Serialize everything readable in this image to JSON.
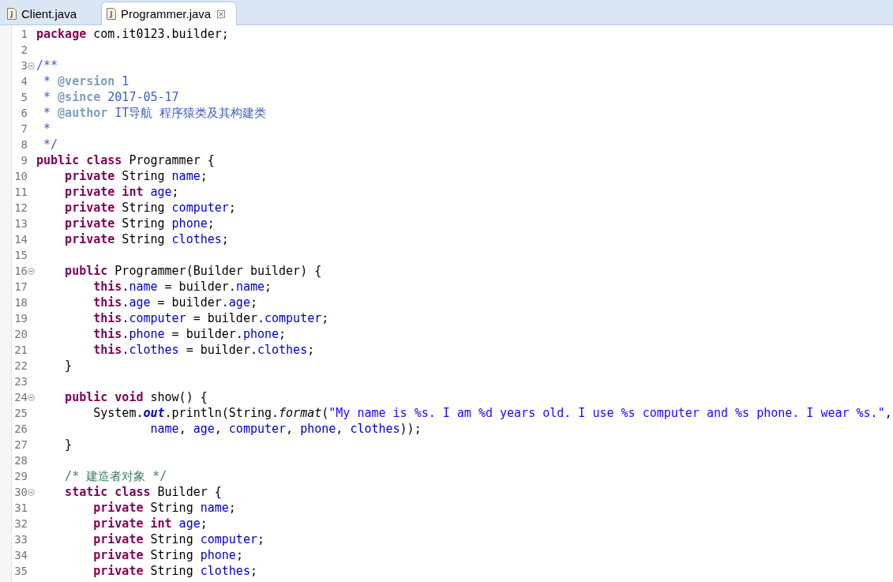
{
  "tabs": [
    {
      "label": "Client.java",
      "selected": false
    },
    {
      "label": "Programmer.java",
      "selected": true
    }
  ],
  "editor": {
    "lines": [
      {
        "number": "1",
        "tokens": [
          {
            "text": "package",
            "kind": "keyword"
          },
          {
            "text": " com.it0123.builder;",
            "kind": "plain"
          }
        ]
      },
      {
        "number": "2"
      },
      {
        "number": "3",
        "expanded": true,
        "tokens": [
          {
            "text": "/**",
            "kind": "javadoc"
          }
        ]
      },
      {
        "number": "4",
        "tokens": [
          {
            "text": " * ",
            "kind": "javadoc"
          },
          {
            "text": "@version",
            "kind": "javadoc-tag"
          },
          {
            "text": " 1",
            "kind": "javadoc"
          }
        ]
      },
      {
        "number": "5",
        "tokens": [
          {
            "text": " * ",
            "kind": "javadoc"
          },
          {
            "text": "@since",
            "kind": "javadoc-tag"
          },
          {
            "text": " 2017-05-17",
            "kind": "javadoc"
          }
        ]
      },
      {
        "number": "6",
        "tokens": [
          {
            "text": " * ",
            "kind": "javadoc"
          },
          {
            "text": "@author",
            "kind": "javadoc-tag"
          },
          {
            "text": " IT导航 程序猿类及其构建类",
            "kind": "javadoc"
          }
        ]
      },
      {
        "number": "7",
        "tokens": [
          {
            "text": " *",
            "kind": "javadoc"
          }
        ]
      },
      {
        "number": "8",
        "tokens": [
          {
            "text": " */",
            "kind": "javadoc"
          }
        ]
      },
      {
        "number": "9",
        "tokens": [
          {
            "text": "public class",
            "kind": "keyword"
          },
          {
            "text": " Programmer {",
            "kind": "plain"
          }
        ]
      },
      {
        "number": "10",
        "tokens": [
          {
            "text": "    private",
            "kind": "keyword"
          },
          {
            "text": " String ",
            "kind": "plain"
          },
          {
            "text": "name",
            "kind": "field"
          },
          {
            "text": ";",
            "kind": "plain"
          }
        ]
      },
      {
        "number": "11",
        "tokens": [
          {
            "text": "    private int",
            "kind": "keyword"
          },
          {
            "text": " age",
            "kind": "field"
          },
          {
            "text": ";",
            "kind": "plain"
          }
        ]
      },
      {
        "number": "12",
        "tokens": [
          {
            "text": "    private",
            "kind": "keyword"
          },
          {
            "text": " String ",
            "kind": "plain"
          },
          {
            "text": "computer",
            "kind": "field"
          },
          {
            "text": ";",
            "kind": "plain"
          }
        ]
      },
      {
        "number": "13",
        "tokens": [
          {
            "text": "    private",
            "kind": "keyword"
          },
          {
            "text": " String ",
            "kind": "plain"
          },
          {
            "text": "phone",
            "kind": "field"
          },
          {
            "text": ";",
            "kind": "plain"
          }
        ]
      },
      {
        "number": "14",
        "tokens": [
          {
            "text": "    private",
            "kind": "keyword"
          },
          {
            "text": " String ",
            "kind": "plain"
          },
          {
            "text": "clothes",
            "kind": "field"
          },
          {
            "text": ";",
            "kind": "plain"
          }
        ]
      },
      {
        "number": "15"
      },
      {
        "number": "16",
        "expanded": true,
        "tokens": [
          {
            "text": "    public",
            "kind": "keyword"
          },
          {
            "text": " Programmer(Builder builder) {",
            "kind": "plain"
          }
        ]
      },
      {
        "number": "17",
        "tokens": [
          {
            "text": "        this",
            "kind": "keyword"
          },
          {
            "text": ".",
            "kind": "plain"
          },
          {
            "text": "name",
            "kind": "field"
          },
          {
            "text": " = builder.",
            "kind": "plain"
          },
          {
            "text": "name",
            "kind": "field"
          },
          {
            "text": ";",
            "kind": "plain"
          }
        ]
      },
      {
        "number": "18",
        "tokens": [
          {
            "text": "        this",
            "kind": "keyword"
          },
          {
            "text": ".",
            "kind": "plain"
          },
          {
            "text": "age",
            "kind": "field"
          },
          {
            "text": " = builder.",
            "kind": "plain"
          },
          {
            "text": "age",
            "kind": "field"
          },
          {
            "text": ";",
            "kind": "plain"
          }
        ]
      },
      {
        "number": "19",
        "tokens": [
          {
            "text": "        this",
            "kind": "keyword"
          },
          {
            "text": ".",
            "kind": "plain"
          },
          {
            "text": "computer",
            "kind": "field"
          },
          {
            "text": " = builder.",
            "kind": "plain"
          },
          {
            "text": "computer",
            "kind": "field"
          },
          {
            "text": ";",
            "kind": "plain"
          }
        ]
      },
      {
        "number": "20",
        "tokens": [
          {
            "text": "        this",
            "kind": "keyword"
          },
          {
            "text": ".",
            "kind": "plain"
          },
          {
            "text": "phone",
            "kind": "field"
          },
          {
            "text": " = builder.",
            "kind": "plain"
          },
          {
            "text": "phone",
            "kind": "field"
          },
          {
            "text": ";",
            "kind": "plain"
          }
        ]
      },
      {
        "number": "21",
        "tokens": [
          {
            "text": "        this",
            "kind": "keyword"
          },
          {
            "text": ".",
            "kind": "plain"
          },
          {
            "text": "clothes",
            "kind": "field"
          },
          {
            "text": " = builder.",
            "kind": "plain"
          },
          {
            "text": "clothes",
            "kind": "field"
          },
          {
            "text": ";",
            "kind": "plain"
          }
        ]
      },
      {
        "number": "22",
        "tokens": [
          {
            "text": "    }",
            "kind": "plain"
          }
        ]
      },
      {
        "number": "23"
      },
      {
        "number": "24",
        "expanded": true,
        "tokens": [
          {
            "text": "    public void",
            "kind": "keyword"
          },
          {
            "text": " show() {",
            "kind": "plain"
          }
        ]
      },
      {
        "number": "25",
        "tokens": [
          {
            "text": "        System.",
            "kind": "plain"
          },
          {
            "text": "out",
            "kind": "static-field"
          },
          {
            "text": ".println(String.",
            "kind": "plain"
          },
          {
            "text": "format",
            "kind": "static-method"
          },
          {
            "text": "(",
            "kind": "plain"
          },
          {
            "text": "\"My name is %s. I am %d years old. I use %s computer and %s phone. I wear %s.\"",
            "kind": "string"
          },
          {
            "text": ",",
            "kind": "plain"
          }
        ]
      },
      {
        "number": "26",
        "tokens": [
          {
            "text": "                name",
            "kind": "field"
          },
          {
            "text": ", ",
            "kind": "plain"
          },
          {
            "text": "age",
            "kind": "field"
          },
          {
            "text": ", ",
            "kind": "plain"
          },
          {
            "text": "computer",
            "kind": "field"
          },
          {
            "text": ", ",
            "kind": "plain"
          },
          {
            "text": "phone",
            "kind": "field"
          },
          {
            "text": ", ",
            "kind": "plain"
          },
          {
            "text": "clothes",
            "kind": "field"
          },
          {
            "text": "));",
            "kind": "plain"
          }
        ]
      },
      {
        "number": "27",
        "tokens": [
          {
            "text": "    }",
            "kind": "plain"
          }
        ]
      },
      {
        "number": "28"
      },
      {
        "number": "29",
        "tokens": [
          {
            "text": "    /* 建造者对象 */",
            "kind": "comment"
          }
        ]
      },
      {
        "number": "30",
        "expanded": true,
        "tokens": [
          {
            "text": "    static class",
            "kind": "keyword"
          },
          {
            "text": " Builder {",
            "kind": "plain"
          }
        ]
      },
      {
        "number": "31",
        "tokens": [
          {
            "text": "        private",
            "kind": "keyword"
          },
          {
            "text": " String ",
            "kind": "plain"
          },
          {
            "text": "name",
            "kind": "field"
          },
          {
            "text": ";",
            "kind": "plain"
          }
        ]
      },
      {
        "number": "32",
        "tokens": [
          {
            "text": "        private int",
            "kind": "keyword"
          },
          {
            "text": " age",
            "kind": "field"
          },
          {
            "text": ";",
            "kind": "plain"
          }
        ]
      },
      {
        "number": "33",
        "tokens": [
          {
            "text": "        private",
            "kind": "keyword"
          },
          {
            "text": " String ",
            "kind": "plain"
          },
          {
            "text": "computer",
            "kind": "field"
          },
          {
            "text": ";",
            "kind": "plain"
          }
        ]
      },
      {
        "number": "34",
        "tokens": [
          {
            "text": "        private",
            "kind": "keyword"
          },
          {
            "text": " String ",
            "kind": "plain"
          },
          {
            "text": "phone",
            "kind": "field"
          },
          {
            "text": ";",
            "kind": "plain"
          }
        ]
      },
      {
        "number": "35",
        "tokens": [
          {
            "text": "        private",
            "kind": "keyword"
          },
          {
            "text": " String ",
            "kind": "plain"
          },
          {
            "text": "clothes",
            "kind": "field"
          },
          {
            "text": ";",
            "kind": "plain"
          }
        ]
      }
    ]
  }
}
